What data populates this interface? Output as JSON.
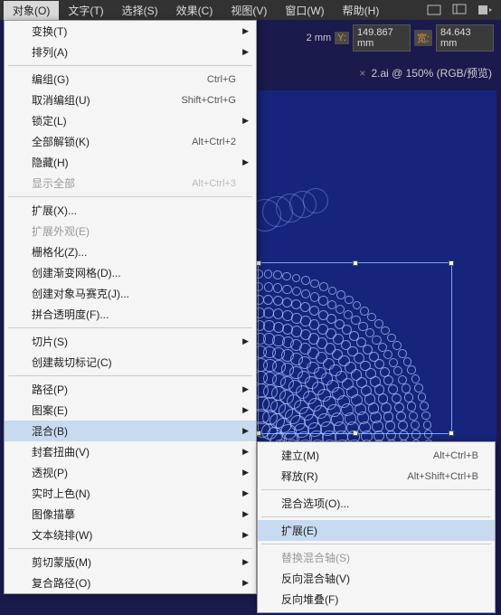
{
  "menubar": {
    "items": [
      "对象(O)",
      "文字(T)",
      "选择(S)",
      "效果(C)",
      "视图(V)",
      "窗口(W)",
      "帮助(H)"
    ],
    "active_index": 0
  },
  "toolbar": {
    "x_unit": "2 mm",
    "y_label": "Y:",
    "y_value": "149.867",
    "y_unit": "mm",
    "w_label": "宽:",
    "w_value": "84.643",
    "w_unit": "mm"
  },
  "tab": {
    "title": "2.ai @ 150% (RGB/预览)",
    "close": "×"
  },
  "dropdown": {
    "groups": [
      [
        {
          "label": "变换(T)",
          "submenu": true
        },
        {
          "label": "排列(A)",
          "submenu": true
        }
      ],
      [
        {
          "label": "编组(G)",
          "shortcut": "Ctrl+G"
        },
        {
          "label": "取消编组(U)",
          "shortcut": "Shift+Ctrl+G"
        },
        {
          "label": "锁定(L)",
          "submenu": true
        },
        {
          "label": "全部解锁(K)",
          "shortcut": "Alt+Ctrl+2"
        },
        {
          "label": "隐藏(H)",
          "submenu": true
        },
        {
          "label": "显示全部",
          "shortcut": "Alt+Ctrl+3",
          "disabled": true
        }
      ],
      [
        {
          "label": "扩展(X)..."
        },
        {
          "label": "扩展外观(E)",
          "disabled": true
        },
        {
          "label": "栅格化(Z)..."
        },
        {
          "label": "创建渐变网格(D)..."
        },
        {
          "label": "创建对象马赛克(J)..."
        },
        {
          "label": "拼合透明度(F)..."
        }
      ],
      [
        {
          "label": "切片(S)",
          "submenu": true
        },
        {
          "label": "创建裁切标记(C)"
        }
      ],
      [
        {
          "label": "路径(P)",
          "submenu": true
        },
        {
          "label": "图案(E)",
          "submenu": true
        },
        {
          "label": "混合(B)",
          "submenu": true,
          "highlight": true
        },
        {
          "label": "封套扭曲(V)",
          "submenu": true
        },
        {
          "label": "透视(P)",
          "submenu": true
        },
        {
          "label": "实时上色(N)",
          "submenu": true
        },
        {
          "label": "图像描摹",
          "submenu": true
        },
        {
          "label": "文本绕排(W)",
          "submenu": true
        }
      ],
      [
        {
          "label": "剪切蒙版(M)",
          "submenu": true
        },
        {
          "label": "复合路径(O)",
          "submenu": true
        }
      ]
    ]
  },
  "submenu": {
    "groups": [
      [
        {
          "label": "建立(M)",
          "shortcut": "Alt+Ctrl+B"
        },
        {
          "label": "释放(R)",
          "shortcut": "Alt+Shift+Ctrl+B"
        }
      ],
      [
        {
          "label": "混合选项(O)..."
        }
      ],
      [
        {
          "label": "扩展(E)",
          "highlight": true
        }
      ],
      [
        {
          "label": "替换混合轴(S)",
          "disabled": true
        },
        {
          "label": "反向混合轴(V)"
        },
        {
          "label": "反向堆叠(F)"
        }
      ]
    ]
  }
}
